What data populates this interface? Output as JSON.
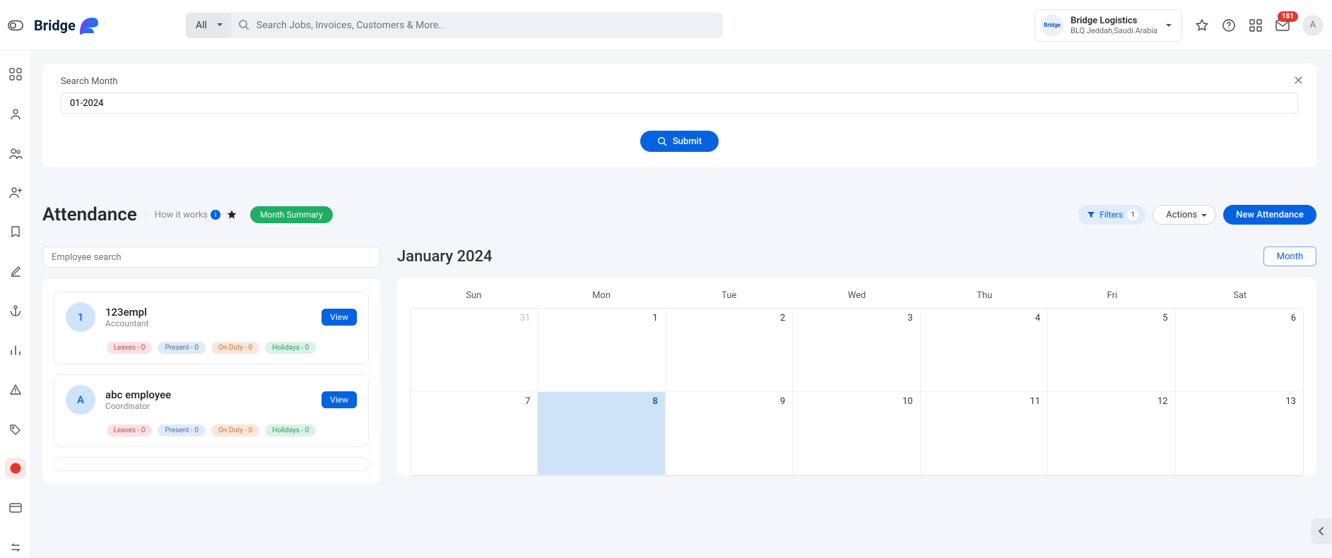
{
  "topbar": {
    "search_scope": "All",
    "search_placeholder": "Search Jobs, Invoices, Customers & More..",
    "org": {
      "name": "Bridge Logistics",
      "location": "BLQ Jeddah,Saudi Arabia",
      "logo_text": "Bridge"
    },
    "mail_badge": "181",
    "avatar_initial": "A"
  },
  "search_card": {
    "label": "Search Month",
    "value": "01-2024",
    "submit_label": "Submit"
  },
  "section": {
    "title": "Attendance",
    "how_label": "How it works",
    "month_summary_label": "Month Summary",
    "filters_label": "Filters",
    "filters_count": "1",
    "actions_label": "Actions",
    "new_label": "New Attendance",
    "emp_search_placeholder": "Employee search"
  },
  "employees": [
    {
      "initial": "1",
      "name": "123empl",
      "role": "Accountant",
      "view": "View",
      "leaves": "Leaves - 0",
      "present": "Present - 0",
      "onduty": "On Duty - 0",
      "holidays": "Holidays - 0"
    },
    {
      "initial": "A",
      "name": "abc employee",
      "role": "Coordinator",
      "view": "View",
      "leaves": "Leaves - 0",
      "present": "Present - 0",
      "onduty": "On Duty - 0",
      "holidays": "Holidays - 0"
    }
  ],
  "calendar": {
    "title": "January 2024",
    "month_btn": "Month",
    "days": [
      "Sun",
      "Mon",
      "Tue",
      "Wed",
      "Thu",
      "Fri",
      "Sat"
    ],
    "rows": [
      [
        {
          "d": "31",
          "other": true
        },
        {
          "d": "1"
        },
        {
          "d": "2"
        },
        {
          "d": "3"
        },
        {
          "d": "4"
        },
        {
          "d": "5"
        },
        {
          "d": "6"
        }
      ],
      [
        {
          "d": "7"
        },
        {
          "d": "8",
          "today": true
        },
        {
          "d": "9"
        },
        {
          "d": "10"
        },
        {
          "d": "11"
        },
        {
          "d": "12"
        },
        {
          "d": "13"
        }
      ]
    ]
  }
}
